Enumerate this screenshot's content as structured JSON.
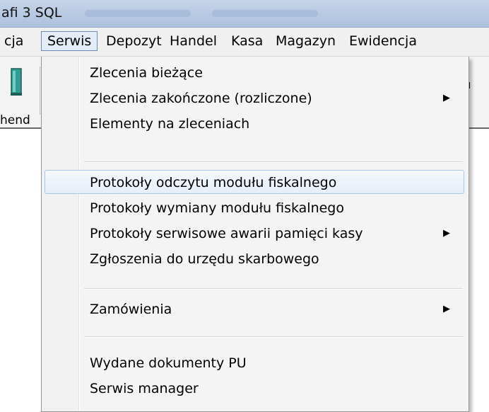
{
  "window": {
    "title": "afi 3 SQL"
  },
  "menubar": {
    "items": [
      {
        "label": "cja"
      },
      {
        "label": "Serwis"
      },
      {
        "label": "Depozyt"
      },
      {
        "label": "Handel"
      },
      {
        "label": "Kasa"
      },
      {
        "label": "Magazyn"
      },
      {
        "label": "Ewidencja"
      }
    ]
  },
  "toolbar": {
    "left_label": "hend",
    "right_label": "ı"
  },
  "dropdown": {
    "groups": [
      [
        {
          "label": "Zlecenia bieżące",
          "submenu": false
        },
        {
          "label": "Zlecenia zakończone (rozliczone)",
          "submenu": true,
          "arrow": "▶"
        },
        {
          "label": "Elementy na zleceniach",
          "submenu": false
        }
      ],
      [
        {
          "label": "Protokoły odczytu modułu fiskalnego",
          "submenu": false,
          "highlighted": true
        },
        {
          "label": "Protokoły wymiany modułu fiskalnego",
          "submenu": false
        },
        {
          "label": "Protokoły serwisowe awarii pamięci kasy",
          "submenu": true,
          "arrow": "▶"
        },
        {
          "label": "Zgłoszenia do urzędu skarbowego",
          "submenu": false
        }
      ],
      [
        {
          "label": "Zamówienia",
          "submenu": true,
          "arrow": "▶"
        }
      ],
      [
        {
          "label": "Wydane dokumenty PU",
          "submenu": false
        },
        {
          "label": "Serwis manager",
          "submenu": false
        }
      ]
    ]
  },
  "colors": {
    "highlight_border": "#a8c6ea",
    "menubar_open_border": "#6c8cb5",
    "titlebar": "#b7c9e2"
  }
}
